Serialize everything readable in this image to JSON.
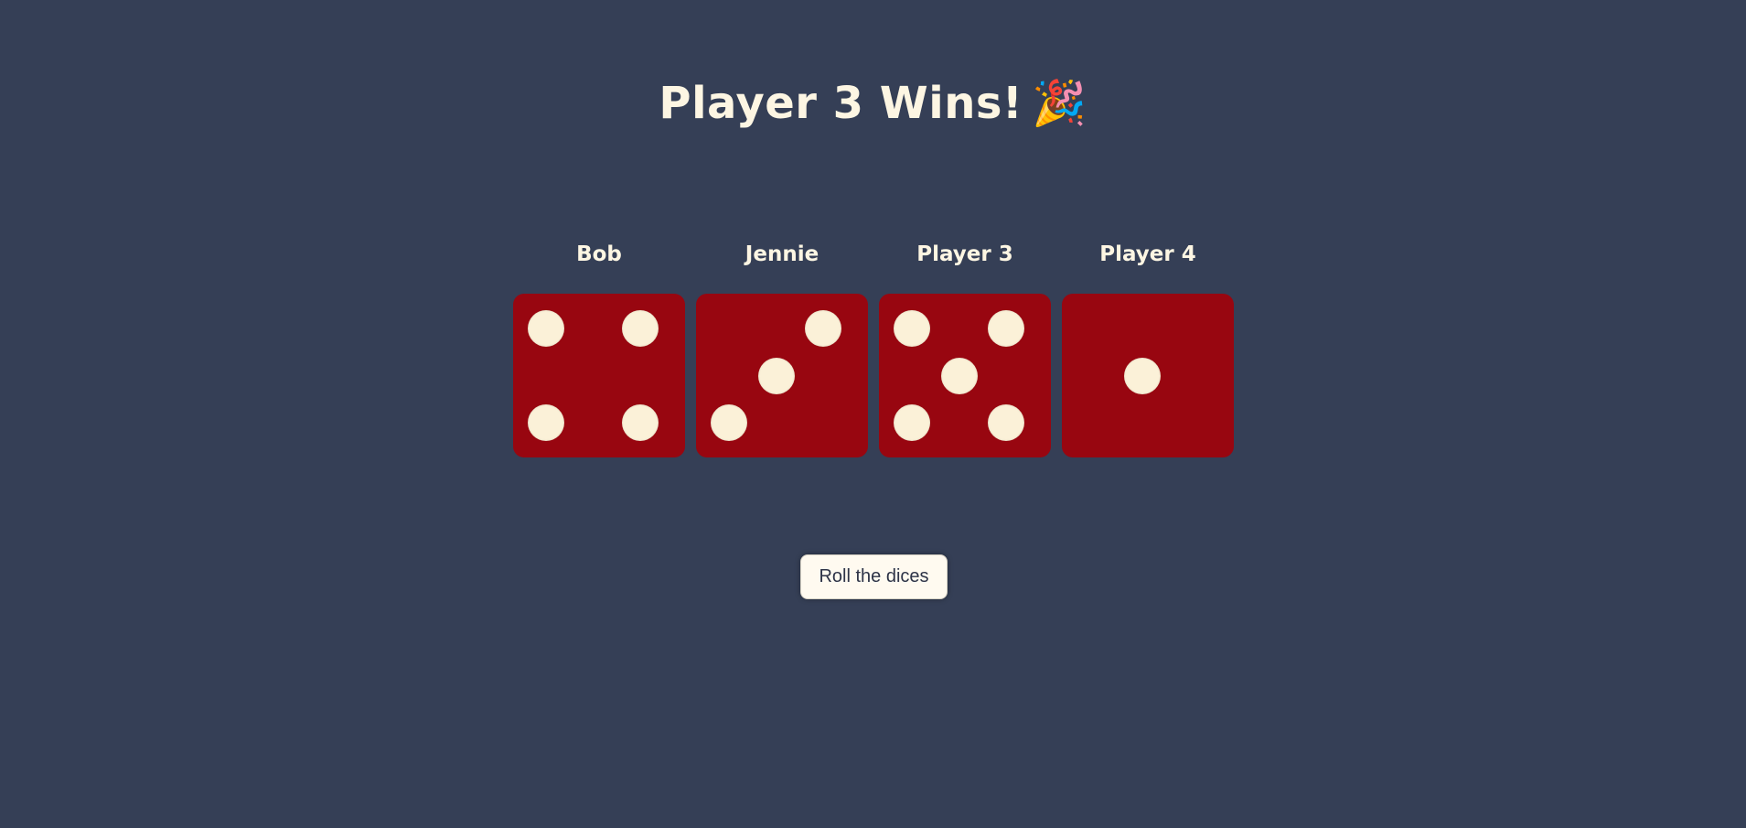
{
  "header": {
    "title": "Player 3 Wins!",
    "emoji": "🎉"
  },
  "players": [
    {
      "name": "Bob",
      "roll": 4
    },
    {
      "name": "Jennie",
      "roll": 3
    },
    {
      "name": "Player 3",
      "roll": 5
    },
    {
      "name": "Player 4",
      "roll": 1
    }
  ],
  "controls": {
    "roll_label": "Roll the dices"
  },
  "colors": {
    "background": "#353f56",
    "die": "#980610",
    "pip": "#fbf1d8",
    "text": "#fdf6e3"
  }
}
